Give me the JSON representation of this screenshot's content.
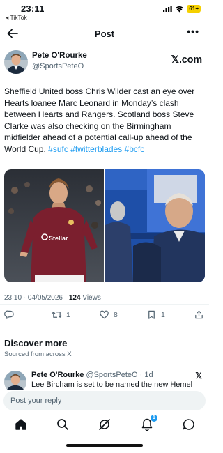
{
  "status_bar": {
    "time": "23:11",
    "back_app": "◂ TikTok",
    "battery": "61+"
  },
  "header": {
    "title": "Post"
  },
  "tweet": {
    "author_name": "Pete O'Rourke",
    "author_handle": "@SportsPeteO",
    "source_logo": "𝕏.com",
    "text_plain": "Sheffield United boss Chris Wilder cast an eye over Hearts loanee Marc Leonard in Monday’s clash between Hearts and Rangers. Scotland boss Steve Clarke was also checking on the Birmingham midfielder ahead of a potential call-up ahead of the World Cup. ",
    "hashtags": [
      "#sufc",
      "#twitterblades",
      "#bcfc"
    ],
    "timestamp": "23:10 · 04/05/2026 · ",
    "views_count": "124",
    "views_label": " Views"
  },
  "actions": {
    "replies": "",
    "reposts": "1",
    "likes": "8",
    "bookmarks": "1"
  },
  "discover": {
    "title": "Discover more",
    "subtitle": "Sourced from across X",
    "rec_name": "Pete O'Rourke",
    "rec_meta": " @SportsPeteO · 1d",
    "rec_text": "Lee Bircham is set to be named the new Hemel"
  },
  "reply": {
    "placeholder": "Post your reply"
  },
  "nav": {
    "notifications_badge": "1"
  },
  "colors": {
    "accent": "#1d9bf0",
    "text": "#0f1419",
    "muted": "#536471"
  },
  "icons": [
    "back-arrow-icon",
    "more-icon",
    "reply-icon",
    "repost-icon",
    "like-icon",
    "bookmark-icon",
    "share-icon",
    "home-icon",
    "search-icon",
    "grok-icon",
    "notifications-icon",
    "messages-icon"
  ]
}
